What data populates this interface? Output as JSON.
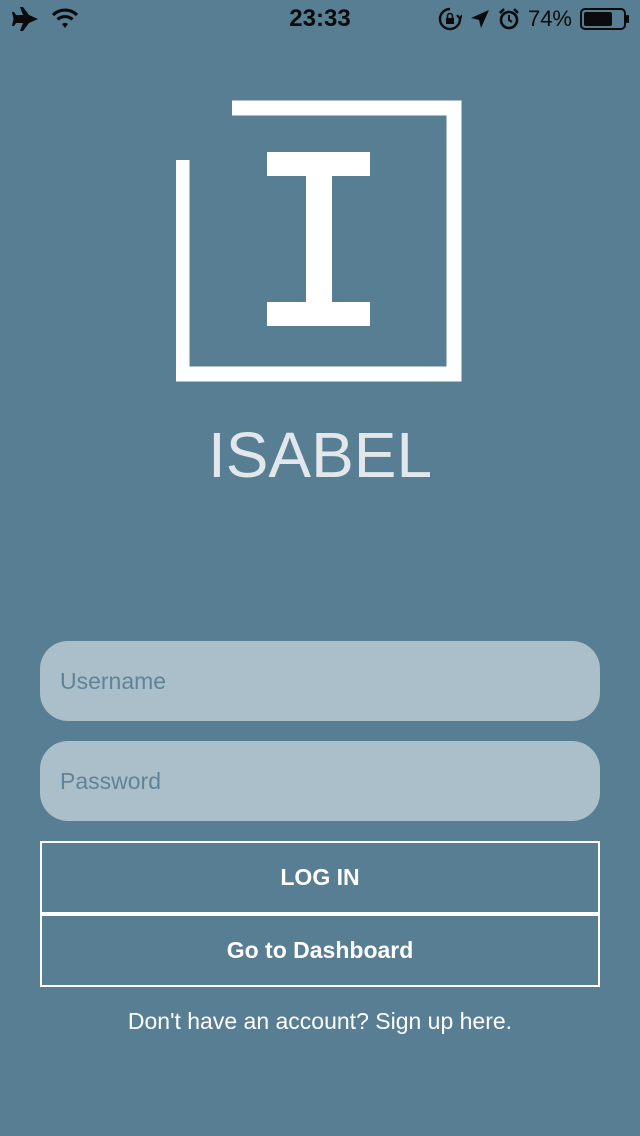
{
  "status_bar": {
    "time": "23:33",
    "battery_percent": "74%",
    "battery_level": 0.74,
    "icons": [
      "airplane-icon",
      "wifi-icon",
      "rotation-lock-icon",
      "location-arrow-icon",
      "alarm-icon",
      "battery-icon"
    ]
  },
  "brand": {
    "logo_icon": "isabel-logo-icon",
    "name": "ISABEL"
  },
  "login_form": {
    "username_placeholder": "Username",
    "password_placeholder": "Password",
    "login_label": "LOG IN",
    "dashboard_label": "Go to Dashboard",
    "signup_text": "Don't have an account? Sign up here."
  },
  "colors": {
    "background": "#587e94",
    "input_background": "#aabfca",
    "placeholder": "#5f8498",
    "text": "#ffffff",
    "brand_name": "#e1e7eb"
  }
}
